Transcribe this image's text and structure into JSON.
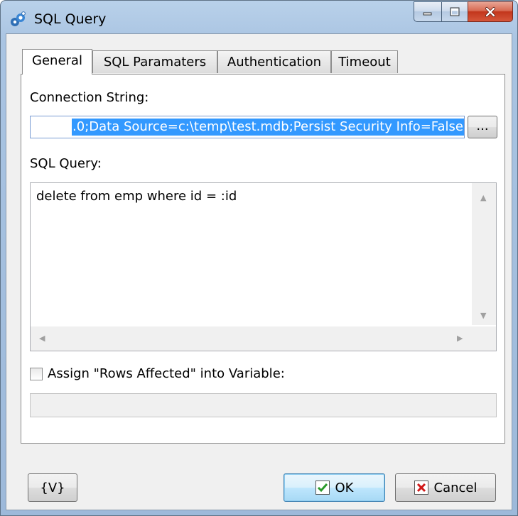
{
  "window": {
    "title": "SQL Query",
    "icon": "sql-query-app-icon",
    "caption_buttons": [
      "minimize-icon",
      "maximize-icon",
      "close-icon"
    ]
  },
  "tabs": [
    {
      "label": "General",
      "active": true
    },
    {
      "label": "SQL Paramaters",
      "active": false
    },
    {
      "label": "Authentication",
      "active": false
    },
    {
      "label": "Timeout",
      "active": false
    }
  ],
  "general": {
    "connection_label": "Connection String:",
    "connection_value": ".0;Data Source=c:\\temp\\test.mdb;Persist Security Info=False",
    "browse_label": "...",
    "sql_label": "SQL Query:",
    "sql_value": "delete from emp where id = :id",
    "assign_label": "Assign \"Rows Affected\" into Variable:",
    "assign_checked": false,
    "variable_value": ""
  },
  "footer": {
    "variable_button": "{V}",
    "ok_button": "OK",
    "cancel_button": "Cancel"
  },
  "colors": {
    "selection": "#3399ff",
    "ok_check": "#2a9a2a",
    "cancel_x": "#d01818",
    "title_bar": "#a9c4e2"
  }
}
